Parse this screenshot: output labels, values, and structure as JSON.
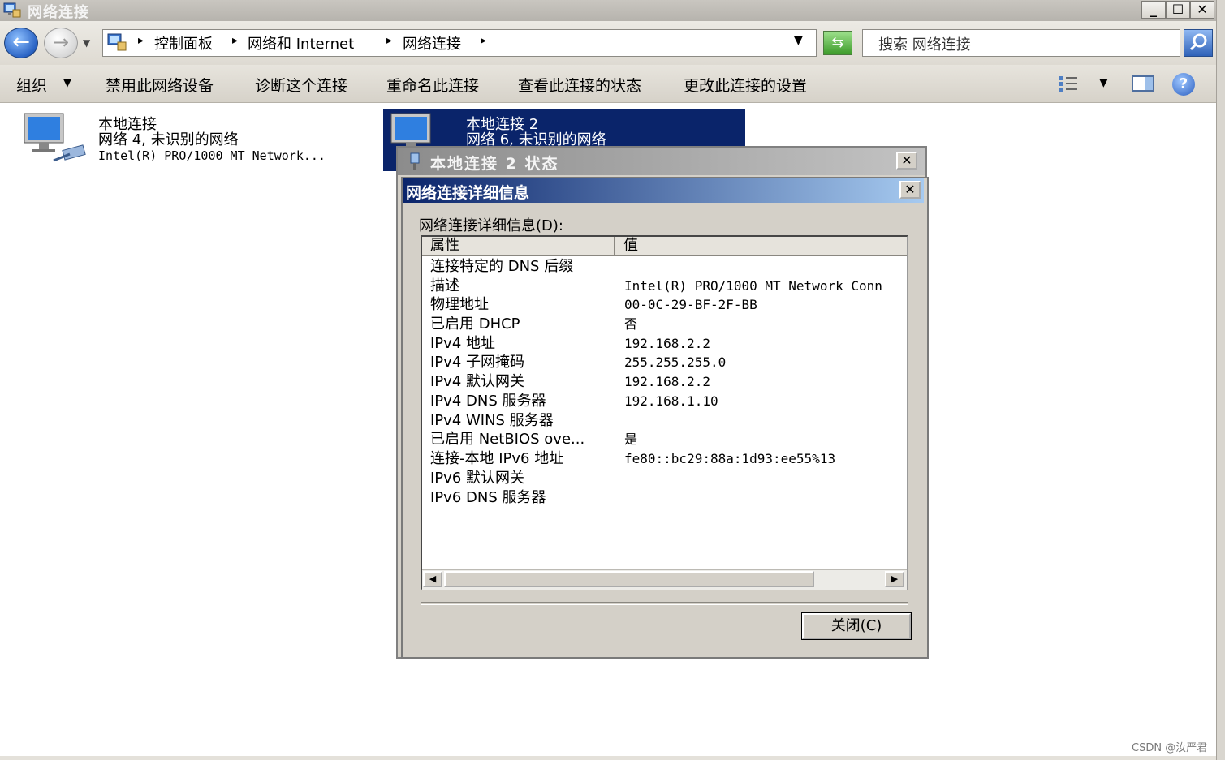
{
  "window": {
    "title": "网络连接"
  },
  "address_bar": {
    "breadcrumbs": [
      "控制面板",
      "网络和 Internet",
      "网络连接"
    ],
    "search_placeholder": "搜索 网络连接"
  },
  "toolbar": {
    "items": [
      "组织",
      "禁用此网络设备",
      "诊断这个连接",
      "重命名此连接",
      "查看此连接的状态",
      "更改此连接的设置"
    ]
  },
  "connections": [
    {
      "name": "本地连接",
      "network": "网络  4, 未识别的网络",
      "adapter": "Intel(R) PRO/1000 MT Network..."
    },
    {
      "name": "本地连接 2",
      "network": "网络  6, 未识别的网络"
    }
  ],
  "status_dialog": {
    "title": "本地连接 2 状态"
  },
  "details_dialog": {
    "title": "网络连接详细信息",
    "label": "网络连接详细信息(D):",
    "columns": [
      "属性",
      "值"
    ],
    "rows": [
      {
        "prop": "连接特定的 DNS 后缀",
        "val": ""
      },
      {
        "prop": "描述",
        "val": "Intel(R) PRO/1000 MT Network Conn"
      },
      {
        "prop": "物理地址",
        "val": "00-0C-29-BF-2F-BB"
      },
      {
        "prop": "已启用 DHCP",
        "val": "否"
      },
      {
        "prop": "IPv4 地址",
        "val": "192.168.2.2"
      },
      {
        "prop": "IPv4 子网掩码",
        "val": "255.255.255.0"
      },
      {
        "prop": "IPv4 默认网关",
        "val": "192.168.2.2"
      },
      {
        "prop": "IPv4 DNS 服务器",
        "val": "192.168.1.10"
      },
      {
        "prop": "IPv4 WINS 服务器",
        "val": ""
      },
      {
        "prop": "已启用 NetBIOS ove...",
        "val": "是"
      },
      {
        "prop": "连接-本地 IPv6 地址",
        "val": "fe80::bc29:88a:1d93:ee55%13"
      },
      {
        "prop": "IPv6 默认网关",
        "val": ""
      },
      {
        "prop": "IPv6 DNS 服务器",
        "val": ""
      }
    ],
    "close_label": "关闭(C)"
  },
  "watermark": "CSDN @汝严君"
}
